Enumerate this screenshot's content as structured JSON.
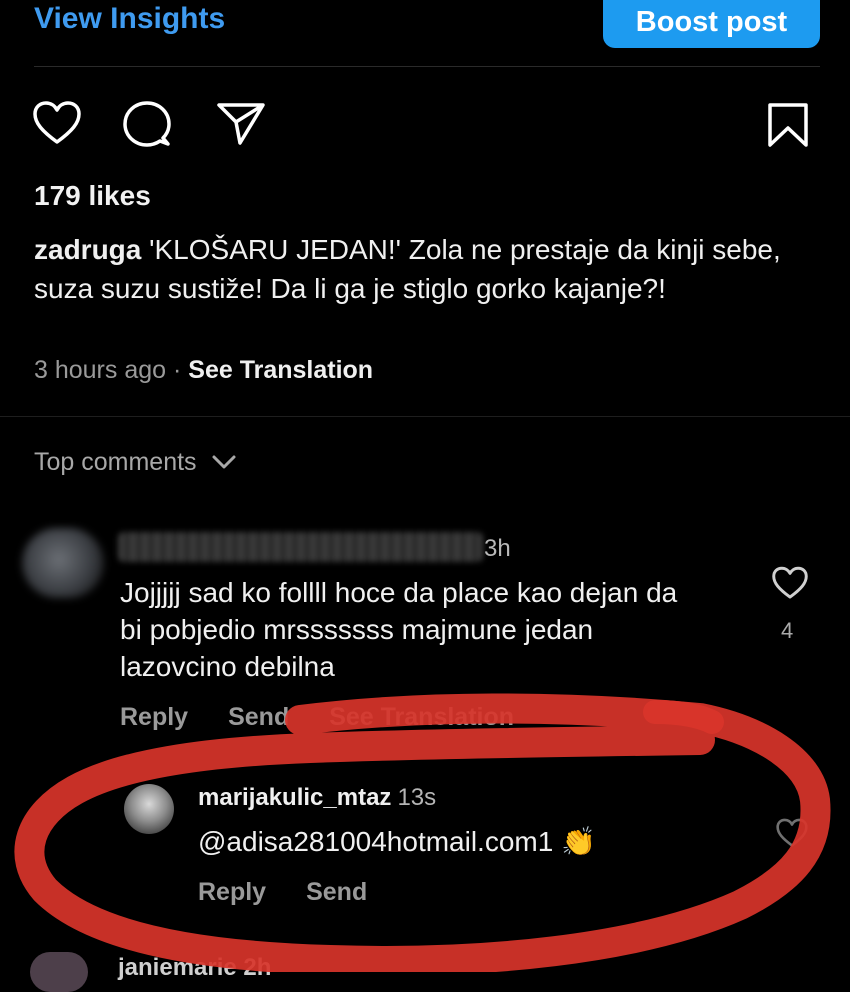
{
  "header": {
    "view_insights": "View Insights",
    "boost_post": "Boost post"
  },
  "post": {
    "likes": "179 likes",
    "caption_user": "zadruga",
    "caption_text": " 'KLOŠARU JEDAN!' Zola ne prestaje da kinji sebe, suza suzu sustiže! Da li ga je stiglo gorko kajanje?!",
    "time": "3 hours ago",
    "separator": "·",
    "see_translation": "See Translation"
  },
  "comments_header": {
    "label": "Top comments"
  },
  "comments": [
    {
      "time": "3h",
      "text": "Jojjjjj sad ko follll hoce da place kao dejan da bi pobjedio mrsssssss majmune jedan lazovcino debilna",
      "like_count": "4",
      "reply": "Reply",
      "send": "Send",
      "see_translation": "See Translation"
    },
    {
      "username": "marijakulic_mtaz",
      "time": "13s",
      "text": "@adisa281004hotmail.com1 👏",
      "reply": "Reply",
      "send": "Send"
    }
  ],
  "partial_next": {
    "username": "janiemarie 2h"
  },
  "colors": {
    "accent": "#1d9bf0",
    "background": "#000000",
    "highlight_scribble": "#e0382b"
  },
  "icons": [
    "heart-icon",
    "comment-icon",
    "share-icon",
    "bookmark-icon",
    "chevron-down-icon"
  ]
}
